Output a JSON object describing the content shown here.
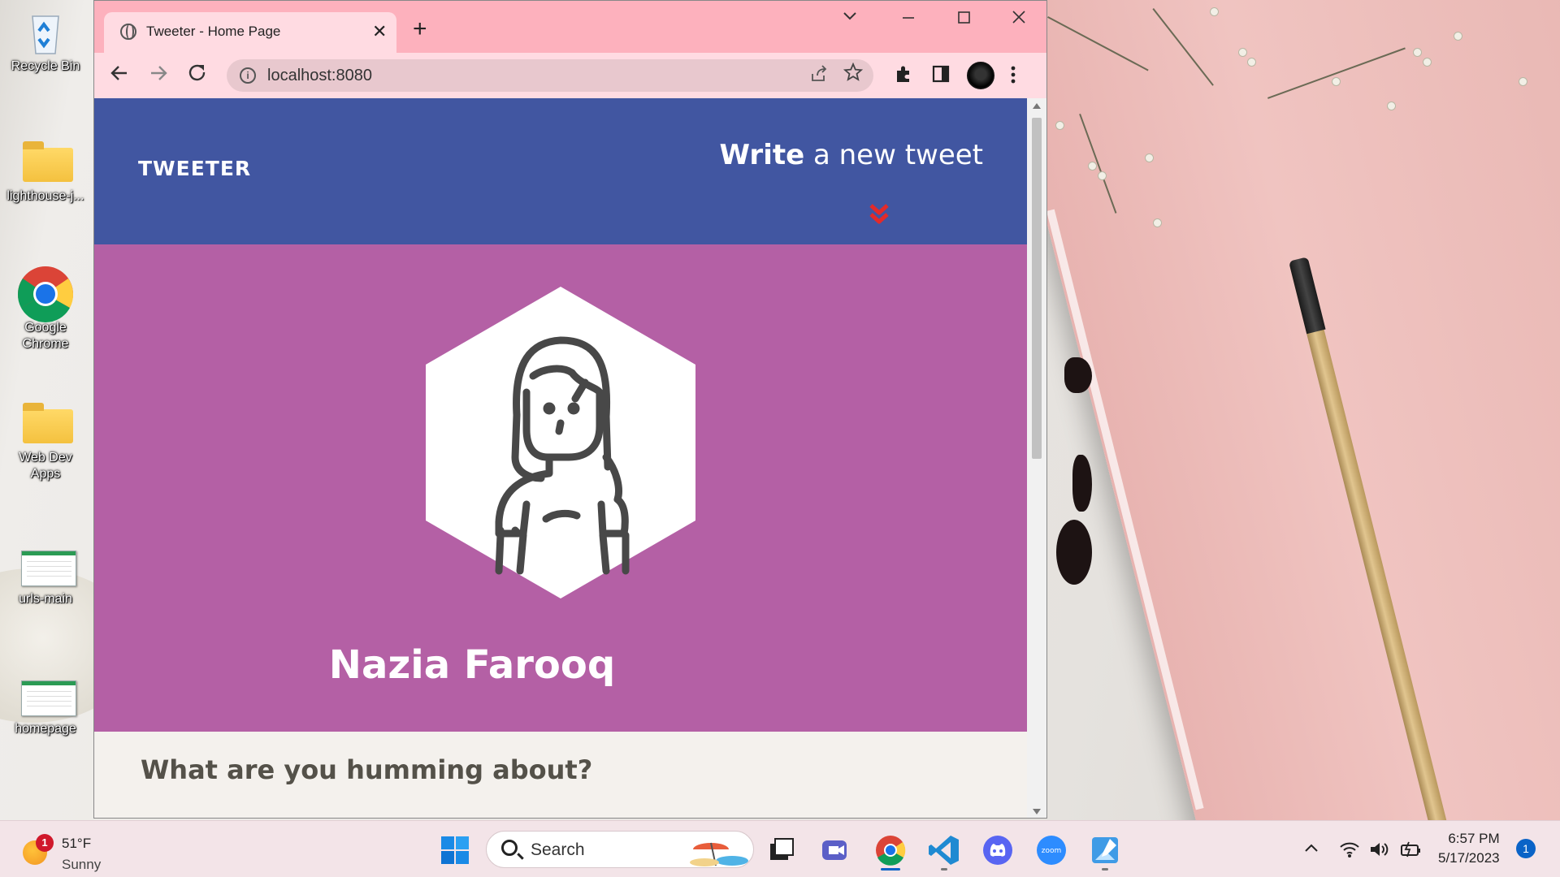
{
  "desktop": {
    "icons": [
      {
        "label": "Recycle Bin"
      },
      {
        "label": "lighthouse-j..."
      },
      {
        "label": "Google Chrome"
      },
      {
        "label": "Web Dev Apps"
      },
      {
        "label": "urls-main"
      },
      {
        "label": "homepage"
      }
    ]
  },
  "browser": {
    "tab_title": "Tweeter - Home Page",
    "tab_close": "✕",
    "new_tab": "+",
    "address": "localhost:8080",
    "page": {
      "brand": "TWEETER",
      "compose_bold": "Write",
      "compose_rest": " a new tweet",
      "profile_name": "Nazia Farooq",
      "composer_prompt": "What are you humming about?"
    },
    "colors": {
      "nav": "#4156a1",
      "profile": "#b460a5",
      "chevron": "#e32a2a"
    }
  },
  "taskbar": {
    "weather_temp": "51°F",
    "weather_desc": "Sunny",
    "weather_badge": "1",
    "search_label": "Search",
    "time": "6:57 PM",
    "date": "5/17/2023",
    "notification_count": "1",
    "apps": [
      "windows-start-icon",
      "task-view-icon",
      "chat-icon",
      "chrome-icon",
      "vscode-icon",
      "discord-icon",
      "zoom-icon",
      "paint-icon"
    ]
  }
}
